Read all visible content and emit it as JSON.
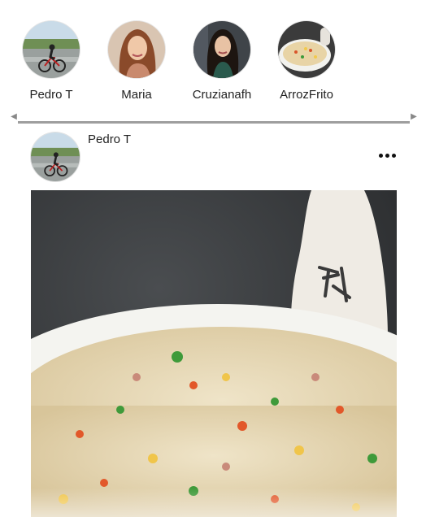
{
  "stories": [
    {
      "name": "Pedro T",
      "avatar_icon": "cyclist-photo"
    },
    {
      "name": "Maria",
      "avatar_icon": "woman-portrait-photo"
    },
    {
      "name": "Cruzianafh",
      "avatar_icon": "woman-portrait-photo"
    },
    {
      "name": "ArrozFrito",
      "avatar_icon": "fried-rice-photo"
    }
  ],
  "post": {
    "author": "Pedro T",
    "avatar_icon": "cyclist-photo",
    "menu_icon": "more-options-icon",
    "image_icon": "fried-rice-photo"
  },
  "colors": {
    "background": "#ffffff",
    "text": "#222222",
    "scroll_thumb": "#9e9e9e"
  }
}
